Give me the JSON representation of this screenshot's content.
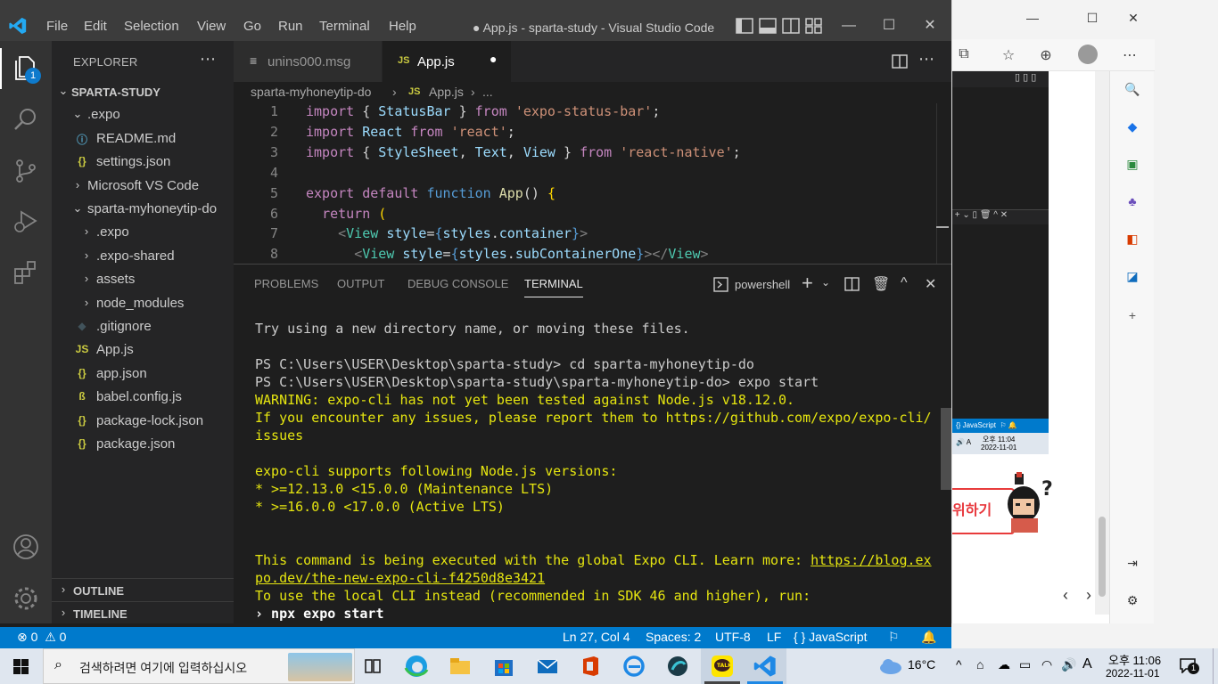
{
  "vscode": {
    "menu": [
      "File",
      "Edit",
      "Selection",
      "View",
      "Go",
      "Run",
      "Terminal",
      "Help"
    ],
    "window_title": "● App.js - sparta-study - Visual Studio Code",
    "explorer_title": "EXPLORER",
    "explorer_badge": "1",
    "tree": [
      {
        "label": "SPARTA-STUDY",
        "icon": "",
        "chev": "⌄",
        "depth": 0,
        "section": true
      },
      {
        "label": ".expo",
        "icon": "",
        "chev": "⌄",
        "depth": 1
      },
      {
        "label": "README.md",
        "icon": "ⓘ",
        "chev": "",
        "depth": 2,
        "color": "#519aba"
      },
      {
        "label": "settings.json",
        "icon": "{}",
        "chev": "",
        "depth": 2,
        "color": "#cbcb41"
      },
      {
        "label": "Microsoft VS Code",
        "icon": "",
        "chev": "›",
        "depth": 1
      },
      {
        "label": "sparta-myhoneytip-do",
        "icon": "",
        "chev": "⌄",
        "depth": 1
      },
      {
        "label": ".expo",
        "icon": "",
        "chev": "›",
        "depth": 2
      },
      {
        "label": ".expo-shared",
        "icon": "",
        "chev": "›",
        "depth": 2
      },
      {
        "label": "assets",
        "icon": "",
        "chev": "›",
        "depth": 2
      },
      {
        "label": "node_modules",
        "icon": "",
        "chev": "›",
        "depth": 2
      },
      {
        "label": ".gitignore",
        "icon": "◆",
        "chev": "",
        "depth": 2,
        "color": "#41535b"
      },
      {
        "label": "App.js",
        "icon": "JS",
        "chev": "",
        "depth": 2,
        "color": "#cbcb41"
      },
      {
        "label": "app.json",
        "icon": "{}",
        "chev": "",
        "depth": 2,
        "color": "#cbcb41"
      },
      {
        "label": "babel.config.js",
        "icon": "ß",
        "chev": "",
        "depth": 2,
        "color": "#cbcb41"
      },
      {
        "label": "package-lock.json",
        "icon": "{}",
        "chev": "",
        "depth": 2,
        "color": "#cbcb41"
      },
      {
        "label": "package.json",
        "icon": "{}",
        "chev": "",
        "depth": 2,
        "color": "#cbcb41"
      }
    ],
    "outline_label": "OUTLINE",
    "timeline_label": "TIMELINE",
    "tabs": [
      {
        "label": "unins000.msg",
        "icon": "≡",
        "active": false
      },
      {
        "label": "App.js",
        "icon": "JS",
        "active": true,
        "dirty": "●"
      }
    ],
    "breadcrumb": [
      "sparta-myhoneytip-do",
      "App.js",
      "..."
    ],
    "code_lines": [
      {
        "n": "1",
        "tokens": [
          [
            "kw",
            "import"
          ],
          [
            "pl",
            " { "
          ],
          [
            "id",
            "StatusBar"
          ],
          [
            "pl",
            " } "
          ],
          [
            "kw",
            "from"
          ],
          [
            "pl",
            " "
          ],
          [
            "st",
            "'expo-status-bar'"
          ],
          [
            "pl",
            ";"
          ]
        ]
      },
      {
        "n": "2",
        "tokens": [
          [
            "kw",
            "import"
          ],
          [
            "pl",
            " "
          ],
          [
            "id",
            "React"
          ],
          [
            "pl",
            " "
          ],
          [
            "kw",
            "from"
          ],
          [
            "pl",
            " "
          ],
          [
            "st",
            "'react'"
          ],
          [
            "pl",
            ";"
          ]
        ]
      },
      {
        "n": "3",
        "tokens": [
          [
            "kw",
            "import"
          ],
          [
            "pl",
            " { "
          ],
          [
            "id",
            "StyleSheet"
          ],
          [
            "pl",
            ", "
          ],
          [
            "id",
            "Text"
          ],
          [
            "pl",
            ", "
          ],
          [
            "id",
            "View"
          ],
          [
            "pl",
            " } "
          ],
          [
            "kw",
            "from"
          ],
          [
            "pl",
            " "
          ],
          [
            "st",
            "'react-native'"
          ],
          [
            "pl",
            ";"
          ]
        ]
      },
      {
        "n": "4",
        "tokens": []
      },
      {
        "n": "5",
        "tokens": [
          [
            "kw",
            "export"
          ],
          [
            "pl",
            " "
          ],
          [
            "kw",
            "default"
          ],
          [
            "pl",
            " "
          ],
          [
            "bl",
            "function"
          ],
          [
            "pl",
            " "
          ],
          [
            "fn",
            "App"
          ],
          [
            "pl",
            "() "
          ],
          [
            "br",
            "{"
          ]
        ]
      },
      {
        "n": "6",
        "tokens": [
          [
            "pl",
            "  "
          ],
          [
            "kw",
            "return"
          ],
          [
            "pl",
            " "
          ],
          [
            "br",
            "("
          ]
        ]
      },
      {
        "n": "7",
        "tokens": [
          [
            "pl",
            "    "
          ],
          [
            "tg",
            "<"
          ],
          [
            "ty",
            "View"
          ],
          [
            "pl",
            " "
          ],
          [
            "id",
            "style"
          ],
          [
            "pl",
            "="
          ],
          [
            "bl",
            "{"
          ],
          [
            "id",
            "styles"
          ],
          [
            "pl",
            "."
          ],
          [
            "id",
            "container"
          ],
          [
            "bl",
            "}"
          ],
          [
            "tg",
            ">"
          ]
        ]
      },
      {
        "n": "8",
        "tokens": [
          [
            "pl",
            "      "
          ],
          [
            "tg",
            "<"
          ],
          [
            "ty",
            "View"
          ],
          [
            "pl",
            " "
          ],
          [
            "id",
            "style"
          ],
          [
            "pl",
            "="
          ],
          [
            "bl",
            "{"
          ],
          [
            "id",
            "styles"
          ],
          [
            "pl",
            "."
          ],
          [
            "id",
            "subContainerOne"
          ],
          [
            "bl",
            "}"
          ],
          [
            "tg",
            "></"
          ],
          [
            "ty",
            "View"
          ],
          [
            "tg",
            ">"
          ]
        ]
      }
    ],
    "panel_tabs": [
      "PROBLEMS",
      "OUTPUT",
      "DEBUG CONSOLE",
      "TERMINAL"
    ],
    "terminal_shell": "powershell",
    "terminal_lines": [
      {
        "t": "Try using a new directory name, or moving these files.",
        "c": ""
      },
      {
        "t": "",
        "c": ""
      },
      {
        "t": "PS C:\\Users\\USER\\Desktop\\sparta-study> cd sparta-myhoneytip-do",
        "c": ""
      },
      {
        "t": "PS C:\\Users\\USER\\Desktop\\sparta-study\\sparta-myhoneytip-do> expo start",
        "c": ""
      },
      {
        "t": "WARNING: expo-cli has not yet been tested against Node.js v18.12.0.",
        "c": "y"
      },
      {
        "t": "If you encounter any issues, please report them to https://github.com/expo/expo-cli/",
        "c": "y"
      },
      {
        "t": "issues",
        "c": "y"
      },
      {
        "t": "",
        "c": ""
      },
      {
        "t": "expo-cli supports following Node.js versions:",
        "c": "y"
      },
      {
        "t": "* >=12.13.0 <15.0.0 (Maintenance LTS)",
        "c": "y"
      },
      {
        "t": "* >=16.0.0 <17.0.0 (Active LTS)",
        "c": "y"
      },
      {
        "t": "",
        "c": ""
      },
      {
        "t": "",
        "c": ""
      },
      {
        "t": "This command is being executed with the global Expo CLI. Learn more: ",
        "c": "y",
        "link": "https://blog.ex"
      },
      {
        "t": "",
        "c": "y",
        "link": "po.dev/the-new-expo-cli-f4250d8e3421"
      },
      {
        "t": "To use the local CLI instead (recommended in SDK 46 and higher), run:",
        "c": "y"
      },
      {
        "t": "› npx expo start",
        "c": "bw"
      }
    ],
    "status": {
      "errors": "0",
      "warnings": "0",
      "position": "Ln 27, Col 4",
      "spaces": "Spaces: 2",
      "encoding": "UTF-8",
      "eol": "LF",
      "language": "JavaScript"
    }
  },
  "edge": {
    "banner_text": "위하기",
    "mini_status_lang": "JavaScript",
    "mini_time": "오후 11:04",
    "mini_date": "2022-11-01"
  },
  "taskbar": {
    "search_placeholder": "검색하려면 여기에 입력하십시오",
    "weather": "16°C",
    "ime": "A",
    "time": "오후 11:06",
    "date": "2022-11-01",
    "notif_count": "1"
  }
}
